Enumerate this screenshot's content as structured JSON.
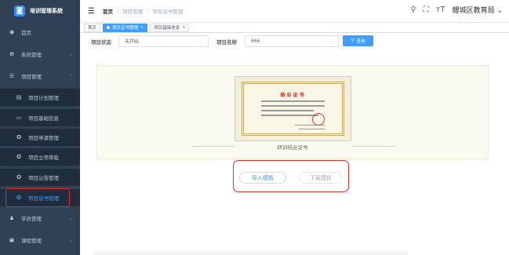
{
  "app": {
    "title": "培训管理系统"
  },
  "sidebar": {
    "items": [
      {
        "label": "首页",
        "icon": "dashboard-icon"
      },
      {
        "label": "系统管理",
        "icon": "gear-icon"
      },
      {
        "label": "项目管理",
        "icon": "list-icon"
      },
      {
        "label": "项目计划管理",
        "icon": "calendar-icon"
      },
      {
        "label": "项目基础信息",
        "icon": "monitor-icon"
      },
      {
        "label": "项目申请管理",
        "icon": "circle-icon"
      },
      {
        "label": "项目立项审批",
        "icon": "circle-icon"
      },
      {
        "label": "项目公告管理",
        "icon": "circle-icon"
      },
      {
        "label": "项目证书管理",
        "icon": "circle-icon"
      },
      {
        "label": "学员管理",
        "icon": "user-icon"
      },
      {
        "label": "课程管理",
        "icon": "book-icon"
      }
    ],
    "active_color": "#409eff"
  },
  "header": {
    "breadcrumb": [
      "首页",
      "项目管理",
      "项目证书管理"
    ],
    "org": "鲤城区教育局"
  },
  "tags": [
    {
      "label": "首页"
    },
    {
      "label": "项目证书管理"
    },
    {
      "label": "项目基础信息"
    }
  ],
  "filter": {
    "status_label": "项目状态",
    "status_value": "未开始",
    "name_label": "项目名称",
    "name_value": "666",
    "search_label": "查询"
  },
  "certificate": {
    "title": "结业证书",
    "caption": "研训结业证书"
  },
  "actions": {
    "import_label": "导入模板",
    "download_label": "下载模板"
  }
}
